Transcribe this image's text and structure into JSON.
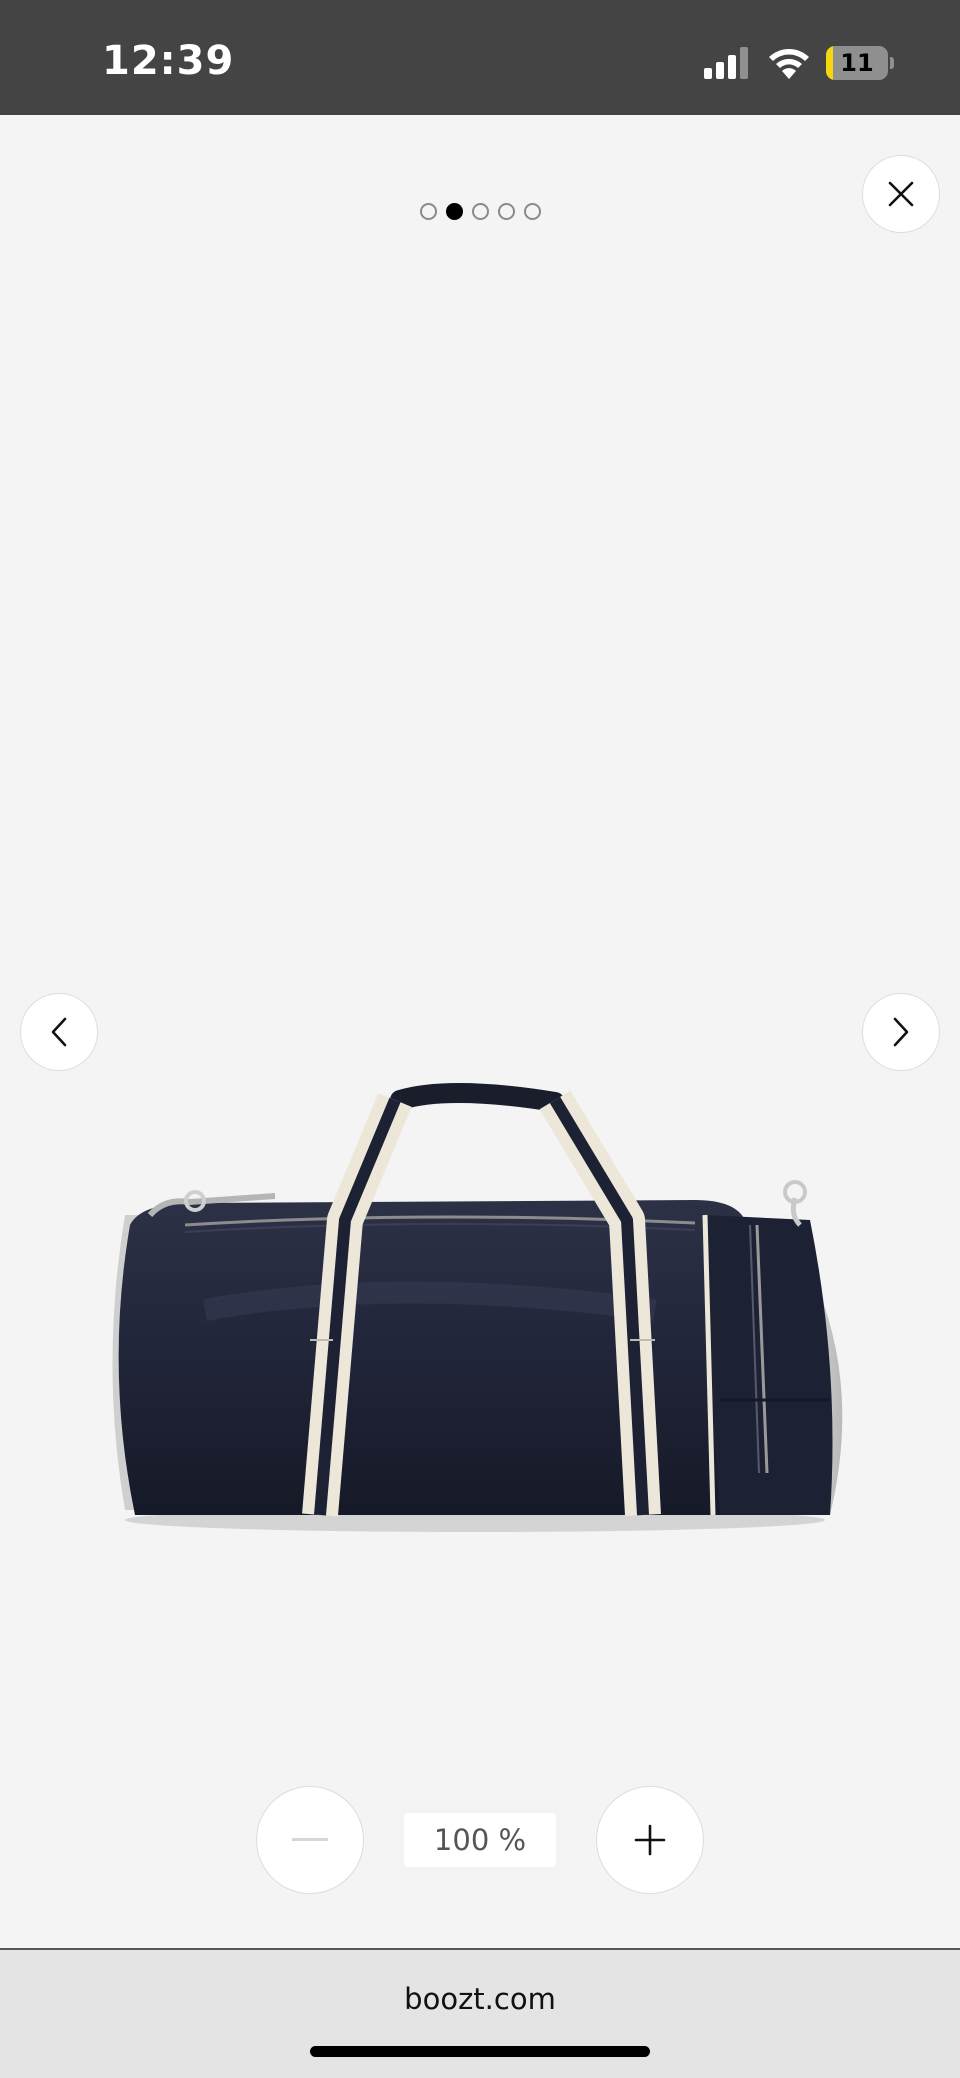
{
  "status_bar": {
    "time": "12:39",
    "battery_level": "11",
    "battery_fraction": 0.11,
    "signal_icon": "cellular-signal-icon",
    "wifi_icon": "wifi-icon"
  },
  "gallery": {
    "page_count": 5,
    "active_index": 1,
    "close_icon": "close-icon",
    "prev_icon": "chevron-left-icon",
    "next_icon": "chevron-right-icon",
    "image_alt": "Navy duffel bag with cream and navy striped handles"
  },
  "zoom": {
    "level": "100 %",
    "zoom_out_icon": "minus-icon",
    "zoom_in_icon": "plus-icon"
  },
  "browser": {
    "url": "boozt.com"
  },
  "colors": {
    "status_bar": "#444444",
    "background": "#f4f4f4",
    "bag_navy": "#1e2235",
    "strap_cream": "#ede7da",
    "battery_yellow": "#f5d60f"
  }
}
